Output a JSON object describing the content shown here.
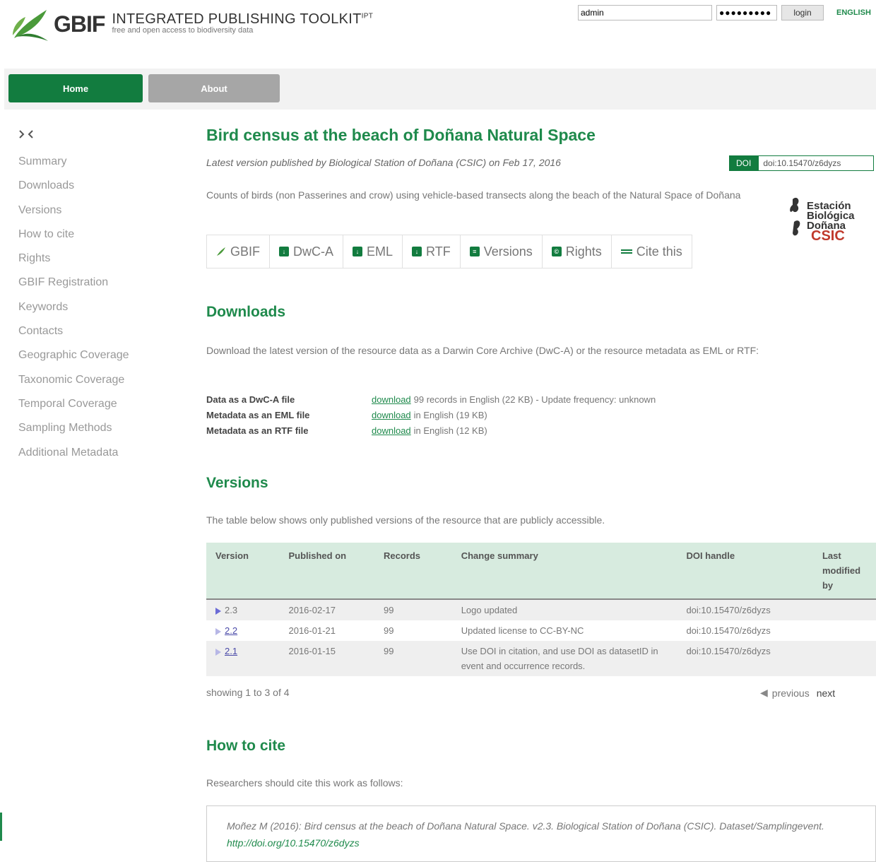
{
  "header": {
    "brand": "GBIF",
    "title": "INTEGRATED PUBLISHING TOOLKIT",
    "title_sup": "IPT",
    "subtitle": "free and open access to biodiversity data",
    "login": {
      "user_value": "admin",
      "password_value": "●●●●●●●●●",
      "login_label": "login"
    },
    "language": "ENGLISH"
  },
  "nav": {
    "home": "Home",
    "about": "About"
  },
  "sidebar": {
    "toc_icon": "toc-icon",
    "items": [
      "Summary",
      "Downloads",
      "Versions",
      "How to cite",
      "Rights",
      "GBIF Registration",
      "Keywords",
      "Contacts",
      "Geographic Coverage",
      "Taxonomic Coverage",
      "Temporal Coverage",
      "Sampling Methods",
      "Additional Metadata"
    ]
  },
  "resource": {
    "title": "Bird census at the beach of Doñana Natural Space",
    "published_line": "Latest version published by Biological Station of Doñana (CSIC) on Feb 17, 2016",
    "doi_label": "DOI",
    "doi_value": "doi:10.15470/z6dyzs",
    "description": "Counts of birds (non Passerines and crow) using vehicle-based transects along the beach of the Natural Space of Doñana",
    "org_logo_lines": [
      "Estación",
      "Biológica",
      "Doñana",
      "CSIC"
    ]
  },
  "toolbar": [
    {
      "icon": "gbif-leaf-icon",
      "glyph": "",
      "label": "GBIF"
    },
    {
      "icon": "download-icon",
      "glyph": "↓",
      "label": "DwC-A"
    },
    {
      "icon": "download-icon",
      "glyph": "↓",
      "label": "EML"
    },
    {
      "icon": "download-icon",
      "glyph": "↓",
      "label": "RTF"
    },
    {
      "icon": "versions-icon",
      "glyph": "≡",
      "label": "Versions"
    },
    {
      "icon": "rights-icon",
      "glyph": "©",
      "label": "Rights"
    },
    {
      "icon": "quote-icon",
      "glyph": "",
      "label": "Cite this"
    }
  ],
  "downloads": {
    "title": "Downloads",
    "intro": "Download the latest version of the resource data as a Darwin Core Archive (DwC-A) or the resource metadata as EML or RTF:",
    "rows": [
      {
        "label": "Data as a DwC-A file",
        "link": "download",
        "info": "99 records in English (22 KB) - Update frequency: unknown"
      },
      {
        "label": "Metadata as an EML file",
        "link": "download",
        "info": "in English (19 KB)"
      },
      {
        "label": "Metadata as an RTF file",
        "link": "download",
        "info": "in English (12 KB)"
      }
    ]
  },
  "versions": {
    "title": "Versions",
    "intro": "The table below shows only published versions of the resource that are publicly accessible.",
    "headers": [
      "Version",
      "Published on",
      "Records",
      "Change summary",
      "DOI handle",
      "Last modified by"
    ],
    "rows": [
      {
        "version": "2.3",
        "published": "2016-02-17",
        "records": "99",
        "summary": "Logo updated",
        "doi": "doi:10.15470/z6dyzs",
        "modified_by": ""
      },
      {
        "version": "2.2",
        "published": "2016-01-21",
        "records": "99",
        "summary": "Updated license to CC-BY-NC",
        "doi": "doi:10.15470/z6dyzs",
        "modified_by": ""
      },
      {
        "version": "2.1",
        "published": "2016-01-15",
        "records": "99",
        "summary": "Use DOI in citation, and use DOI as datasetID in event and occurrence records.",
        "doi": "doi:10.15470/z6dyzs",
        "modified_by": ""
      }
    ],
    "showing": "showing 1 to 3 of 4",
    "previous": "previous",
    "next": "next"
  },
  "cite": {
    "title": "How to cite",
    "intro": "Researchers should cite this work as follows:",
    "text": "Moñez M (2016): Bird census at the beach of Doñana Natural Space. v2.3. Biological Station of Doñana (CSIC). Dataset/Samplingevent.",
    "link": "http://doi.org/10.15470/z6dyzs"
  }
}
